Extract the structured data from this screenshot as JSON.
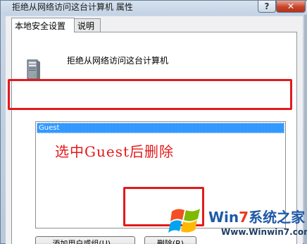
{
  "window": {
    "title": "拒绝从网络访问这台计算机 属性",
    "help_label": "?",
    "close_label": "✕"
  },
  "tabs": [
    {
      "label": "本地安全设置",
      "selected": true
    },
    {
      "label": "说明",
      "selected": false
    }
  ],
  "policy": {
    "icon": "server-computer-icon",
    "title": "拒绝从网络访问这台计算机"
  },
  "accounts": {
    "items": [
      {
        "label": "Guest",
        "selected": true
      }
    ]
  },
  "buttons": {
    "add_label": "添加用户或组(U)...",
    "remove_label": "删除(R)"
  },
  "annotation": {
    "text": "选中Guest后删除",
    "color": "#e31a1a"
  },
  "watermark": {
    "brand_prefix": "Win",
    "brand_seven": "7",
    "brand_suffix": "系统之家",
    "url": "Www.Winwin7.com"
  }
}
